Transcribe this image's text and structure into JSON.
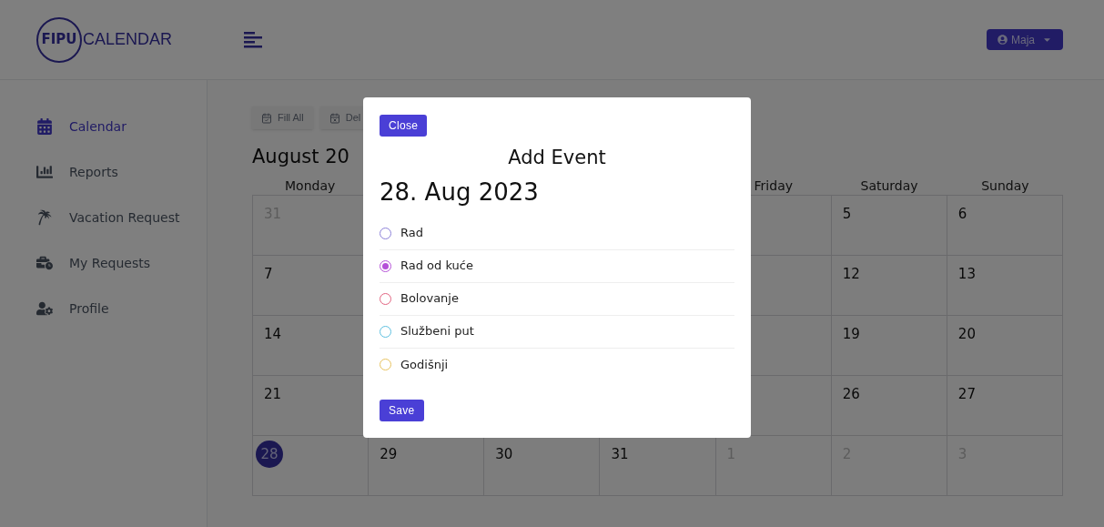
{
  "brand": {
    "badge": "FIPU",
    "name": "CALENDAR"
  },
  "user_menu": {
    "label": "Maja"
  },
  "sidebar": {
    "items": [
      {
        "label": "Calendar",
        "selected": true,
        "kind": "calendar"
      },
      {
        "label": "Reports",
        "selected": false,
        "kind": "reports"
      },
      {
        "label": "Vacation Request",
        "selected": false,
        "kind": "vacation"
      },
      {
        "label": "My Requests",
        "selected": false,
        "kind": "requests"
      },
      {
        "label": "Profile",
        "selected": false,
        "kind": "profile"
      }
    ]
  },
  "toolbar": {
    "buttons": [
      {
        "label": "Fill All",
        "kind": "fill"
      },
      {
        "label": "Del",
        "kind": "delete"
      }
    ]
  },
  "calendar": {
    "title": "August 20",
    "weekdays": {
      "leading": [
        "Monday"
      ],
      "trailing": [
        "Friday",
        "Saturday",
        "Sunday"
      ]
    },
    "weeks": [
      {
        "leading": [
          {
            "day": "31",
            "muted": true,
            "today": false
          }
        ],
        "trailing": [
          {
            "day": "5",
            "muted": false,
            "today": false
          },
          {
            "day": "6",
            "muted": false,
            "today": false
          }
        ]
      },
      {
        "leading": [
          {
            "day": "7",
            "muted": false,
            "today": false
          }
        ],
        "trailing": [
          {
            "day": "12",
            "muted": false,
            "today": false
          },
          {
            "day": "13",
            "muted": false,
            "today": false
          }
        ]
      },
      {
        "leading": [
          {
            "day": "14",
            "muted": false,
            "today": false
          }
        ],
        "trailing": [
          {
            "day": "19",
            "muted": false,
            "today": false
          },
          {
            "day": "20",
            "muted": false,
            "today": false
          }
        ]
      },
      {
        "leading": [
          {
            "day": "21",
            "muted": false,
            "today": false
          }
        ],
        "trailing": [
          {
            "day": "26",
            "muted": false,
            "today": false
          },
          {
            "day": "27",
            "muted": false,
            "today": false
          }
        ]
      },
      {
        "leading": [
          {
            "day": "28",
            "muted": false,
            "today": true
          },
          {
            "day": "29",
            "muted": false,
            "today": false
          },
          {
            "day": "30",
            "muted": false,
            "today": false
          },
          {
            "day": "31",
            "muted": false,
            "today": false
          },
          {
            "day": "1",
            "muted": true,
            "today": false
          },
          {
            "day": "2",
            "muted": true,
            "today": false
          },
          {
            "day": "3",
            "muted": true,
            "today": false
          }
        ]
      }
    ]
  },
  "modal": {
    "close": "Close",
    "title": "Add Event",
    "date": "28. Aug 2023",
    "options": [
      {
        "label": "Rad",
        "selected": false,
        "color": "#8b80d8"
      },
      {
        "label": "Rad od kuće",
        "selected": true,
        "color": "#b550d8"
      },
      {
        "label": "Bolovanje",
        "selected": false,
        "color": "#e2637f"
      },
      {
        "label": "Službeni put",
        "selected": false,
        "color": "#5cbfe0"
      },
      {
        "label": "Godišnji",
        "selected": false,
        "color": "#e8c25c"
      }
    ],
    "save": "Save"
  }
}
